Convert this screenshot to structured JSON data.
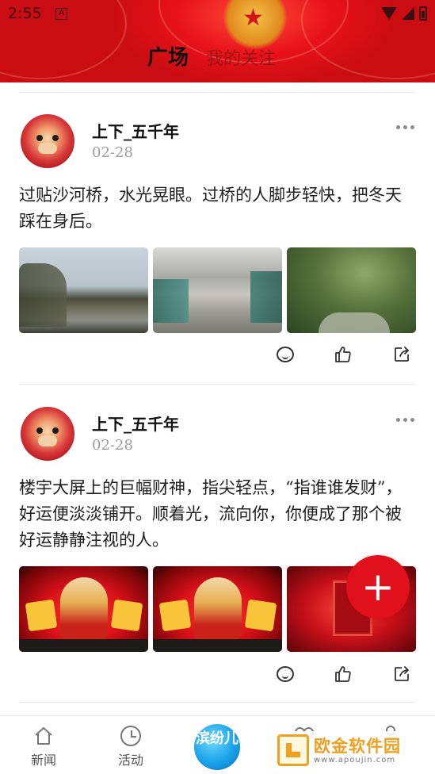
{
  "status_bar": {
    "time": "2:55",
    "app_icon_glyph": "A",
    "icons": [
      "wifi-icon",
      "signal-icon",
      "battery-icon"
    ]
  },
  "header": {
    "tabs": [
      {
        "label": "广场",
        "active": true
      },
      {
        "label": "我的关注",
        "active": false
      }
    ],
    "theme_color": "#e8121a"
  },
  "posts": [
    {
      "author": "上下_五千年",
      "date": "02-28",
      "text": "过贴沙河桥，水光晃眼。过桥的人脚步轻快，把冬天踩在身后。",
      "photos": [
        "river-photo",
        "stairs-photo",
        "park-photo"
      ],
      "actions": [
        "comment-icon",
        "like-icon",
        "share-icon"
      ]
    },
    {
      "author": "上下_五千年",
      "date": "02-28",
      "text": "楼宇大屏上的巨幅财神，指尖轻点，“指谁谁发财”，好运便淡淡铺开。顺着光，流向你，你便成了那个被好运静静注视的人。",
      "photos": [
        "billboard-photo",
        "billboard-photo",
        "billboard-door-photo"
      ],
      "actions": [
        "comment-icon",
        "like-icon",
        "share-icon"
      ]
    }
  ],
  "fab": {
    "label": "+",
    "color": "#e0101d"
  },
  "bottom_nav": {
    "items": [
      {
        "label": "新闻",
        "icon": "home-icon"
      },
      {
        "label": "活动",
        "icon": "clock-icon"
      },
      {
        "label": "滨纷儿",
        "icon": "app-logo"
      },
      {
        "label": "",
        "icon": "heart-icon"
      },
      {
        "label": "",
        "icon": "person-icon"
      }
    ]
  },
  "watermark": {
    "title": "欧金软件园",
    "url": "www.apoujin.com"
  }
}
